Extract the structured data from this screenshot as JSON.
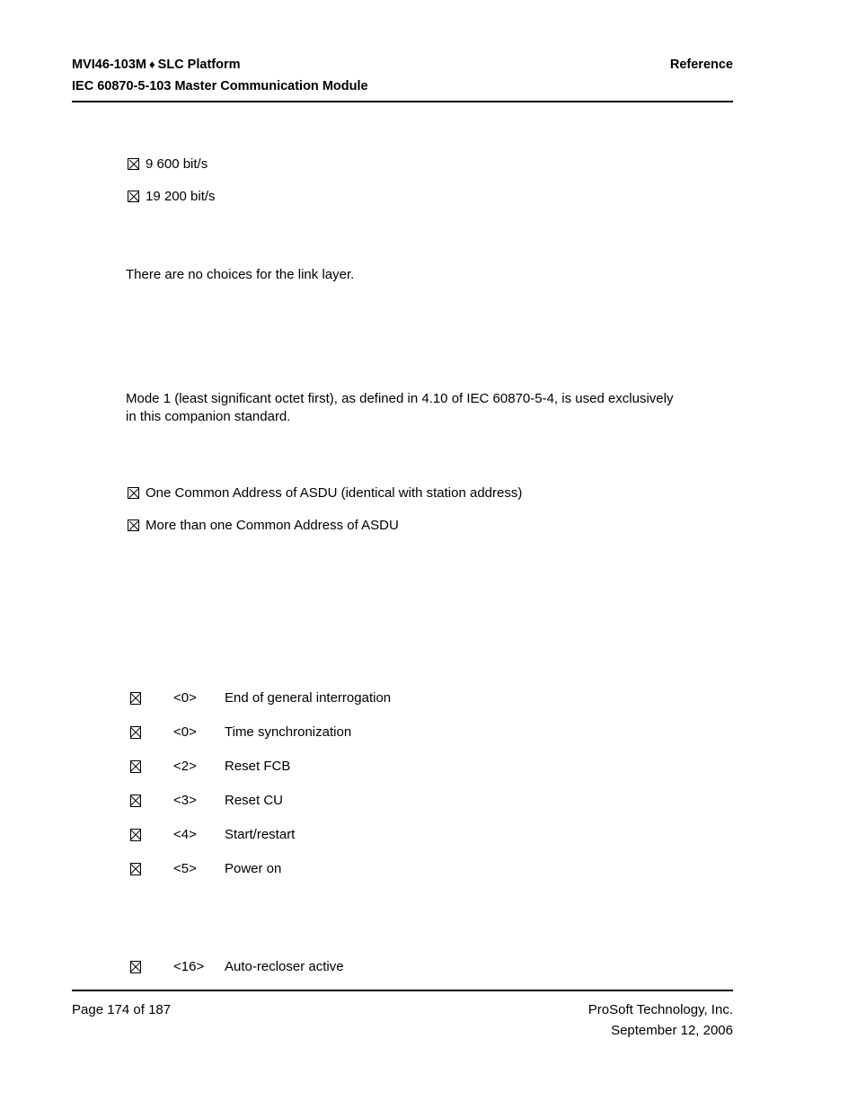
{
  "header": {
    "doc_title": "MVI46-103M",
    "separator_icon": "diamond-icon",
    "separator_glyph": "♦",
    "platform": "SLC Platform",
    "subtitle": "IEC 60870-5-103 Master Communication Module",
    "section": "Reference"
  },
  "baud_rates": {
    "items": [
      {
        "label": "9 600 bit/s"
      },
      {
        "label": "19 200 bit/s"
      }
    ]
  },
  "link_layer": {
    "paragraph": "There are no choices for the link layer."
  },
  "transmission_mode": {
    "paragraph": "Mode 1 (least significant octet first), as defined in 4.10 of IEC 60870-5-4, is used exclusively in this companion standard."
  },
  "common_address": {
    "items": [
      {
        "label": "One Common Address of ASDU (identical with station address)"
      },
      {
        "label": "More than one Common Address of ASDU"
      }
    ]
  },
  "codes": {
    "rows": [
      {
        "code": "<0>",
        "description": "End of general interrogation"
      },
      {
        "code": "<0>",
        "description": "Time synchronization"
      },
      {
        "code": "<2>",
        "description": "Reset FCB"
      },
      {
        "code": "<3>",
        "description": "Reset CU"
      },
      {
        "code": "<4>",
        "description": "Start/restart"
      },
      {
        "code": "<5>",
        "description": "Power on"
      }
    ]
  },
  "codes_second": {
    "rows": [
      {
        "code": "<16>",
        "description": "Auto-recloser active"
      }
    ]
  },
  "footer": {
    "page_label": "Page 174 of 187",
    "company": "ProSoft Technology, Inc.",
    "date": "September 12, 2006"
  }
}
